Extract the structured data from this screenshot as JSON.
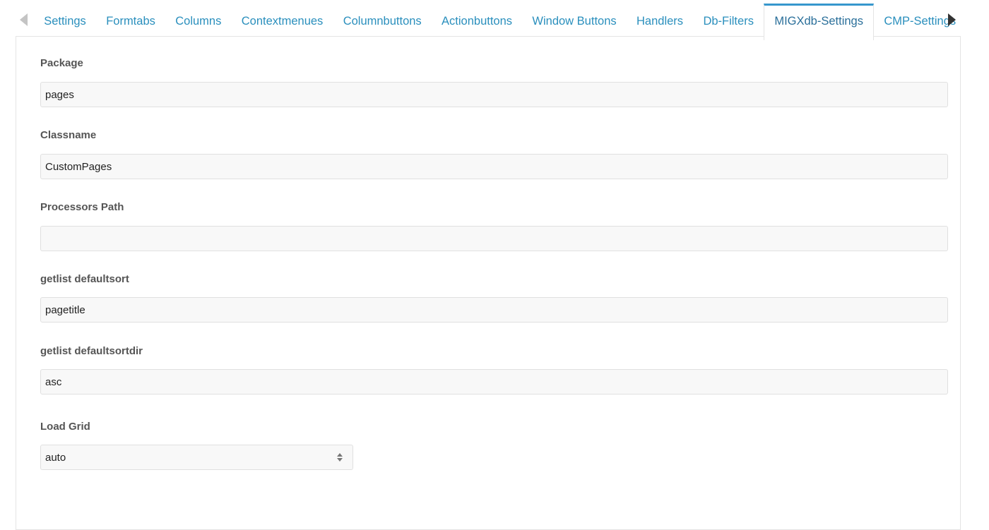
{
  "tabs": [
    {
      "label": "Settings",
      "active": false
    },
    {
      "label": "Formtabs",
      "active": false
    },
    {
      "label": "Columns",
      "active": false
    },
    {
      "label": "Contextmenues",
      "active": false
    },
    {
      "label": "Columnbuttons",
      "active": false
    },
    {
      "label": "Actionbuttons",
      "active": false
    },
    {
      "label": "Window Buttons",
      "active": false
    },
    {
      "label": "Handlers",
      "active": false
    },
    {
      "label": "Db-Filters",
      "active": false
    },
    {
      "label": "MIGXdb-Settings",
      "active": true
    },
    {
      "label": "CMP-Settings",
      "active": false
    }
  ],
  "icons": {
    "scroll_left": "triangle-left-icon",
    "scroll_right": "triangle-right-icon",
    "select_arrows": "up-down-arrows-icon"
  },
  "colors": {
    "tab_text": "#2a8fbd",
    "active_tab_border": "#3697cd",
    "input_bg": "#f8f8f8"
  },
  "form": {
    "package": {
      "label": "Package",
      "value": "pages"
    },
    "classname": {
      "label": "Classname",
      "value": "CustomPages"
    },
    "processors_path": {
      "label": "Processors Path",
      "value": ""
    },
    "getlist_defaultsort": {
      "label": "getlist defaultsort",
      "value": "pagetitle"
    },
    "getlist_defaultsortdir": {
      "label": "getlist defaultsortdir",
      "value": "asc"
    },
    "load_grid": {
      "label": "Load Grid",
      "value": "auto"
    }
  }
}
